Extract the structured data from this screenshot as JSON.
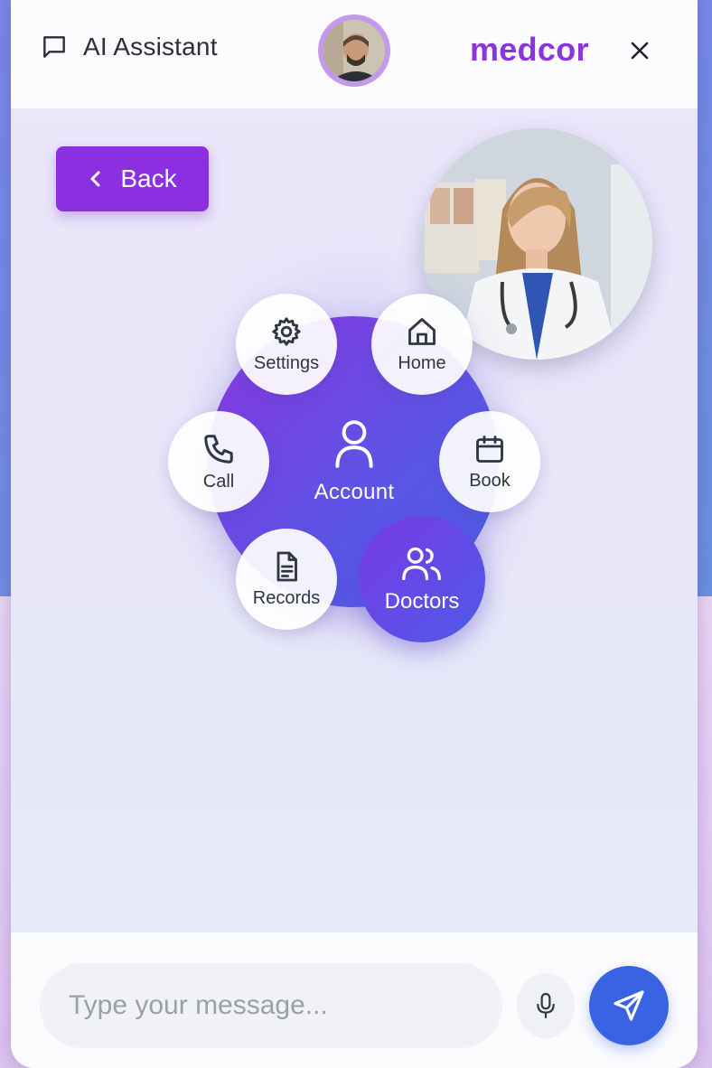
{
  "header": {
    "title": "AI Assistant",
    "brand": "medcor"
  },
  "back_button": {
    "label": "Back"
  },
  "menu": {
    "center": {
      "label": "Account",
      "icon": "user-icon"
    },
    "items": [
      {
        "label": "Settings",
        "icon": "gear-icon"
      },
      {
        "label": "Home",
        "icon": "home-icon"
      },
      {
        "label": "Call",
        "icon": "phone-icon"
      },
      {
        "label": "Book",
        "icon": "calendar-icon"
      },
      {
        "label": "Records",
        "icon": "document-icon"
      },
      {
        "label": "Doctors",
        "icon": "users-icon",
        "active": true
      }
    ]
  },
  "footer": {
    "input_placeholder": "Type your message...",
    "input_value": ""
  },
  "colors": {
    "brand": "#8a35d9",
    "accent": "#8b2fe0",
    "send": "#3a63e4"
  }
}
